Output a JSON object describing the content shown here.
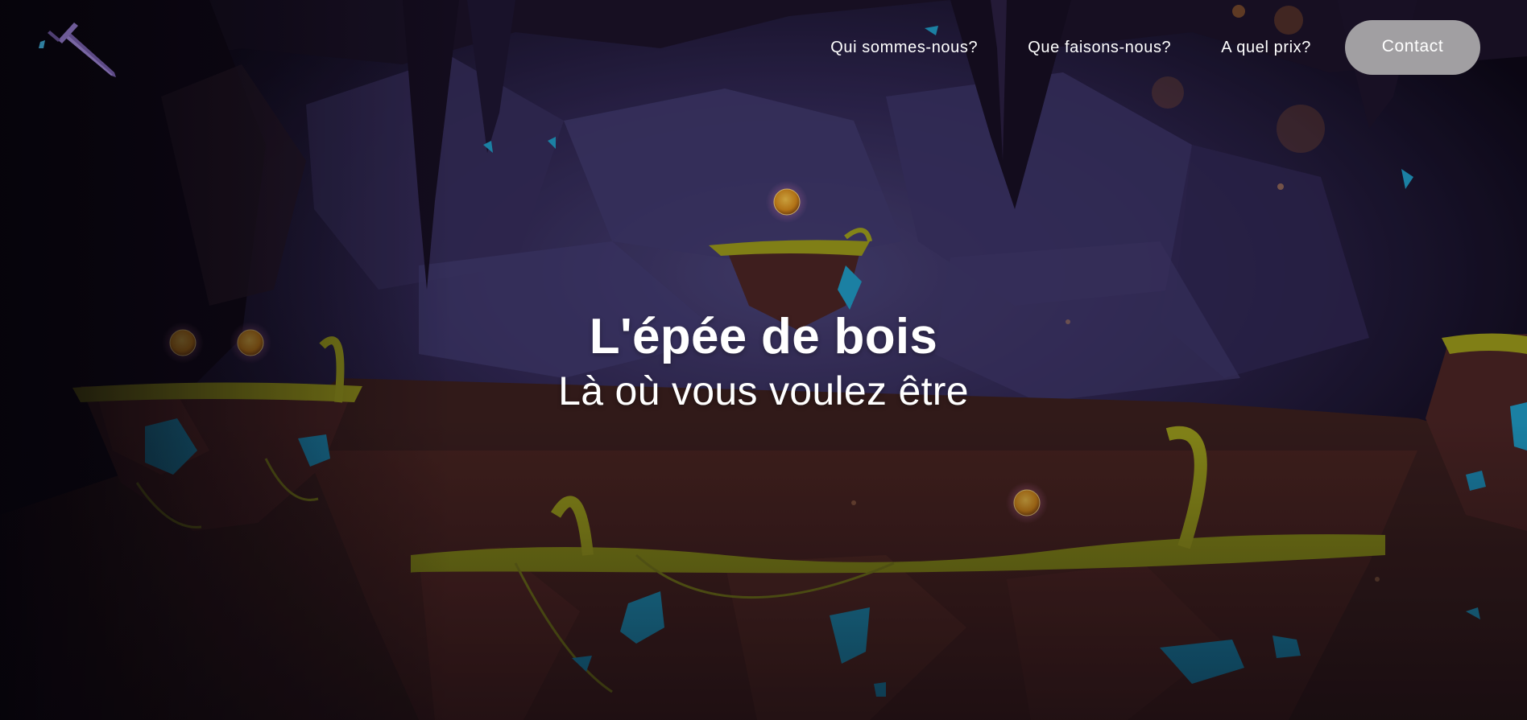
{
  "brand": {
    "logo_icon": "sword-icon"
  },
  "nav": {
    "links": [
      {
        "label": "Qui sommes-nous?"
      },
      {
        "label": "Que faisons-nous?"
      },
      {
        "label": "A quel prix?"
      }
    ],
    "contact_label": "Contact"
  },
  "hero": {
    "title": "L'épée de bois",
    "subtitle": "Là où vous voulez être",
    "background": "cartoon-cave-platform-game-scene"
  },
  "colors": {
    "cave_dark": "#0b0714",
    "cave_purple": "#3a3163",
    "rock_brown": "#4a2520",
    "moss": "#9a9a18",
    "crystal_blue": "#1f9cc4",
    "coin_gold": "#e09a1c",
    "contact_button": "#a19fa2"
  }
}
